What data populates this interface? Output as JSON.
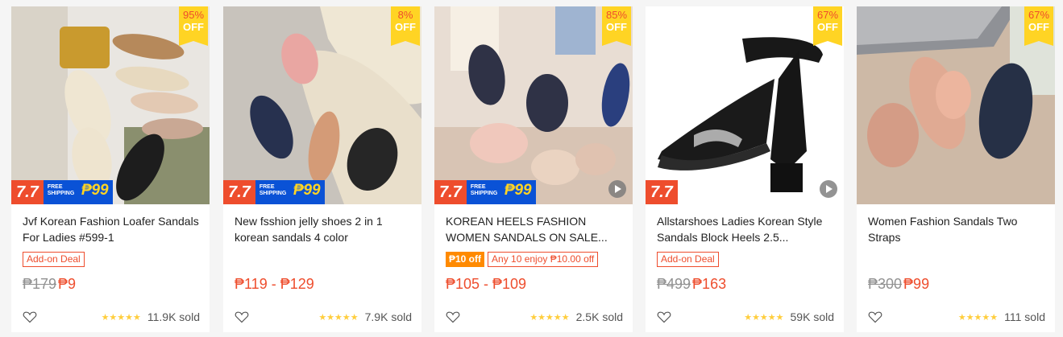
{
  "products": [
    {
      "discount_pct": "95%",
      "discount_off": "OFF",
      "promo_seven": "7.7",
      "promo_free": "FREE",
      "promo_shipping": "SHIPPING",
      "promo_amount": "₱99",
      "has_video": false,
      "title": "Jvf Korean Fashion Loafer Sandals For Ladies #599-1",
      "tags": [
        {
          "text": "Add-on Deal",
          "style": "outline"
        }
      ],
      "price_original": "₱179",
      "price": "₱9",
      "stars": "★★★★★",
      "sold": "11.9K sold"
    },
    {
      "discount_pct": "8%",
      "discount_off": "OFF",
      "promo_seven": "7.7",
      "promo_free": "FREE",
      "promo_shipping": "SHIPPING",
      "promo_amount": "₱99",
      "has_video": false,
      "title": "New fsshion jelly shoes 2 in 1 korean sandals 4 color",
      "tags": [],
      "price_original": "",
      "price": "₱119 - ₱129",
      "stars": "★★★★★",
      "sold": "7.9K sold"
    },
    {
      "discount_pct": "85%",
      "discount_off": "OFF",
      "promo_seven": "7.7",
      "promo_free": "FREE",
      "promo_shipping": "SHIPPING",
      "promo_amount": "₱99",
      "has_video": true,
      "title": "KOREAN HEELS FASHION WOMEN SANDALS ON SALE...",
      "tags": [
        {
          "text": "₱10 off",
          "style": "fill"
        },
        {
          "text": "Any 10 enjoy ₱10.00 off",
          "style": "outline"
        }
      ],
      "price_original": "",
      "price": "₱105 - ₱109",
      "stars": "★★★★★",
      "sold": "2.5K sold"
    },
    {
      "discount_pct": "67%",
      "discount_off": "OFF",
      "promo_seven": "7.7",
      "promo_free": "",
      "promo_shipping": "",
      "promo_amount": "",
      "has_video": true,
      "title": "Allstarshoes Ladies Korean Style Sandals Block Heels 2.5...",
      "tags": [
        {
          "text": "Add-on Deal",
          "style": "outline"
        }
      ],
      "price_original": "₱499",
      "price": "₱163",
      "stars": "★★★★★",
      "sold": "59K sold"
    },
    {
      "discount_pct": "67%",
      "discount_off": "OFF",
      "promo_seven": "",
      "promo_free": "",
      "promo_shipping": "",
      "promo_amount": "",
      "has_video": false,
      "title": "Women Fashion Sandals Two Straps",
      "tags": [],
      "price_original": "₱300",
      "price": "₱99",
      "stars": "★★★★★",
      "sold": "111 sold"
    }
  ],
  "colors": {
    "accent": "#ee4d2d",
    "badge_yellow": "#ffd424",
    "shipping_blue": "#0a52d6",
    "star": "#ffce3d"
  },
  "icons": {
    "favorite": "heart-outline-icon",
    "video": "play-icon",
    "rating": "star-icon"
  }
}
